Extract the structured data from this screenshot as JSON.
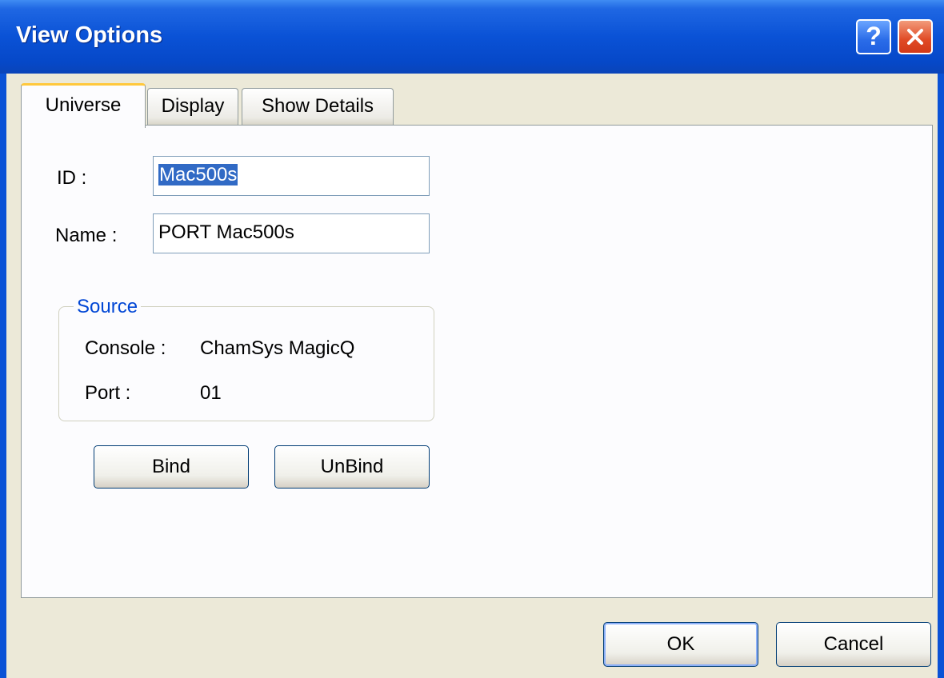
{
  "window": {
    "title": "View Options"
  },
  "titlebar": {
    "help_label": "?"
  },
  "tabs": [
    {
      "label": "Universe"
    },
    {
      "label": "Display"
    },
    {
      "label": "Show Details"
    }
  ],
  "form": {
    "id_label": "ID :",
    "id_value": "Mac500s",
    "name_label": "Name :",
    "name_value": "PORT Mac500s"
  },
  "source": {
    "title": "Source",
    "console_label": "Console :",
    "console_value": "ChamSys MagicQ",
    "port_label": "Port :",
    "port_value": "01"
  },
  "buttons": {
    "bind": "Bind",
    "unbind": "UnBind",
    "ok": "OK",
    "cancel": "Cancel"
  },
  "colors": {
    "titlebar": "#0a52d6",
    "selection": "#316ac5",
    "group_title": "#0046d5",
    "active_tab_accent": "#ffc83c"
  }
}
